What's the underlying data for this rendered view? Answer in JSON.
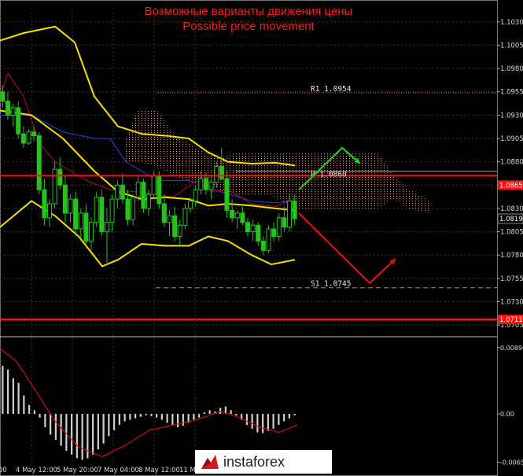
{
  "title_ru": "Возможные варианты движения цены",
  "title_en": "Possible price movement",
  "watermark": "instaforex",
  "colors": {
    "background": "#000000",
    "grid": "#3a3a3a",
    "candle": "#27c21c",
    "bollinger": "#f5e000",
    "kijun": "#1c3ccc",
    "tenkan": "#c20f0f",
    "cloud": "#e0a070",
    "level_red": "#ff1010",
    "arrow_green": "#20d020",
    "arrow_red": "#e01010",
    "macd_hist": "#d0d0d0",
    "macd_signal": "#d01010",
    "axis_text": "#d8d8d8"
  },
  "chart_data": {
    "type": "candlestick",
    "y_axis": {
      "range": [
        1.0695,
        1.1045
      ],
      "ticks": [
        "1.1030",
        "1.1005",
        "1.0980",
        "1.0955",
        "1.0930",
        "1.0905",
        "1.0880",
        "1.0855",
        "1.0830",
        "1.0805",
        "1.0780",
        "1.0755",
        "1.0730",
        "1.0705"
      ],
      "highlighted": [
        {
          "label": "1.0865",
          "value": 1.0855,
          "bg": "#ff1010"
        },
        {
          "label": "1.0819",
          "value": 1.0819,
          "bg": "#000000"
        },
        {
          "label": "1.0711",
          "value": 1.0711,
          "bg": "#ff1010"
        }
      ]
    },
    "x_axis": {
      "ticks": [
        "00",
        "4 May 12:00",
        "5 May 20:00",
        "7 May 04:00",
        "8 May 12:00",
        "11 Ma"
      ]
    },
    "levels": [
      {
        "name": "R1",
        "label": "R1 1.0954",
        "value": 1.0954,
        "style": "dotted-red"
      },
      {
        "name": "P",
        "label": "P 1.0860",
        "value": 1.0865,
        "style": "solid-red"
      },
      {
        "name": "S1",
        "label": "S1 1.0745",
        "value": 1.0745,
        "style": "dashed-red"
      },
      {
        "name": "L",
        "label": "",
        "value": 1.0711,
        "style": "solid-red-thick"
      }
    ],
    "candles": [
      [
        1.0955,
        1.0962,
        1.0938,
        1.0945
      ],
      [
        1.0945,
        1.0955,
        1.0925,
        1.093
      ],
      [
        1.093,
        1.0942,
        1.0918,
        1.0938
      ],
      [
        1.0938,
        1.0945,
        1.0905,
        1.091
      ],
      [
        1.091,
        1.0918,
        1.0895,
        1.09
      ],
      [
        1.09,
        1.0915,
        1.0898,
        1.0912
      ],
      [
        1.0912,
        1.0918,
        1.0902,
        1.0908
      ],
      [
        1.0908,
        1.0912,
        1.0845,
        1.085
      ],
      [
        1.085,
        1.0862,
        1.0812,
        1.082
      ],
      [
        1.082,
        1.084,
        1.081,
        1.0835
      ],
      [
        1.0835,
        1.088,
        1.083,
        1.0872
      ],
      [
        1.0872,
        1.0885,
        1.085,
        1.0855
      ],
      [
        1.0855,
        1.0865,
        1.0815,
        1.0825
      ],
      [
        1.0825,
        1.0845,
        1.0815,
        1.084
      ],
      [
        1.084,
        1.0848,
        1.08,
        1.0808
      ],
      [
        1.0808,
        1.083,
        1.0798,
        1.0825
      ],
      [
        1.0825,
        1.0835,
        1.079,
        1.0795
      ],
      [
        1.0795,
        1.082,
        1.0785,
        1.0815
      ],
      [
        1.0815,
        1.0848,
        1.081,
        1.0842
      ],
      [
        1.0842,
        1.085,
        1.08,
        1.0805
      ],
      [
        1.0805,
        1.083,
        1.077,
        1.0815
      ],
      [
        1.0815,
        1.0845,
        1.0805,
        1.084
      ],
      [
        1.084,
        1.086,
        1.083,
        1.0855
      ],
      [
        1.0855,
        1.0868,
        1.0835,
        1.084
      ],
      [
        1.084,
        1.085,
        1.0812,
        1.0818
      ],
      [
        1.0818,
        1.0845,
        1.0812,
        1.0842
      ],
      [
        1.0842,
        1.0865,
        1.0838,
        1.0858
      ],
      [
        1.0858,
        1.0862,
        1.0825,
        1.083
      ],
      [
        1.083,
        1.085,
        1.0822,
        1.0845
      ],
      [
        1.0845,
        1.087,
        1.084,
        1.0865
      ],
      [
        1.0865,
        1.087,
        1.083,
        1.0835
      ],
      [
        1.0835,
        1.0845,
        1.081,
        1.0815
      ],
      [
        1.0815,
        1.0828,
        1.08,
        1.0822
      ],
      [
        1.0822,
        1.0832,
        1.0795,
        1.08
      ],
      [
        1.08,
        1.0818,
        1.079,
        1.0812
      ],
      [
        1.0812,
        1.0835,
        1.0808,
        1.083
      ],
      [
        1.083,
        1.0842,
        1.0825,
        1.0838
      ],
      [
        1.0838,
        1.0855,
        1.0832,
        1.085
      ],
      [
        1.085,
        1.087,
        1.0845,
        1.0862
      ],
      [
        1.0862,
        1.0868,
        1.0845,
        1.085
      ],
      [
        1.085,
        1.0862,
        1.084,
        1.0858
      ],
      [
        1.0858,
        1.088,
        1.0852,
        1.0875
      ],
      [
        1.0875,
        1.0895,
        1.086,
        1.0862
      ],
      [
        1.0862,
        1.087,
        1.082,
        1.0828
      ],
      [
        1.0828,
        1.084,
        1.0815,
        1.082
      ],
      [
        1.082,
        1.0828,
        1.0808,
        1.0825
      ],
      [
        1.0825,
        1.0832,
        1.0812,
        1.0815
      ],
      [
        1.0815,
        1.082,
        1.08,
        1.0805
      ],
      [
        1.0805,
        1.0818,
        1.0795,
        1.0812
      ],
      [
        1.0812,
        1.0815,
        1.079,
        1.0795
      ],
      [
        1.0795,
        1.08,
        1.078,
        1.0785
      ],
      [
        1.0785,
        1.0812,
        1.0782,
        1.0808
      ],
      [
        1.0808,
        1.0815,
        1.0795,
        1.08
      ],
      [
        1.08,
        1.0825,
        1.0795,
        1.082
      ],
      [
        1.082,
        1.0832,
        1.0805,
        1.081
      ],
      [
        1.081,
        1.0845,
        1.0805,
        1.0838
      ],
      [
        1.0838,
        1.0845,
        1.0812,
        1.0819
      ]
    ],
    "bollinger_upper": [
      [
        0,
        1.101
      ],
      [
        30,
        1.1018
      ],
      [
        70,
        1.1025
      ],
      [
        95,
        1.1008
      ],
      [
        120,
        1.095
      ],
      [
        150,
        1.0918
      ],
      [
        180,
        1.091
      ],
      [
        210,
        1.0908
      ],
      [
        240,
        1.0905
      ],
      [
        265,
        1.089
      ],
      [
        290,
        1.088
      ],
      [
        320,
        1.0878
      ],
      [
        350,
        1.0879
      ],
      [
        375,
        1.0876
      ]
    ],
    "bollinger_mid": [
      [
        0,
        1.0935
      ],
      [
        40,
        1.093
      ],
      [
        80,
        1.0905
      ],
      [
        120,
        1.087
      ],
      [
        150,
        1.0848
      ],
      [
        180,
        1.084
      ],
      [
        210,
        1.0842
      ],
      [
        240,
        1.084
      ],
      [
        265,
        1.0833
      ],
      [
        290,
        1.0835
      ],
      [
        320,
        1.0833
      ],
      [
        350,
        1.083
      ],
      [
        375,
        1.0828
      ]
    ],
    "bollinger_lower": [
      [
        0,
        1.081
      ],
      [
        40,
        1.0838
      ],
      [
        70,
        1.0822
      ],
      [
        100,
        1.08
      ],
      [
        130,
        1.0768
      ],
      [
        150,
        1.0775
      ],
      [
        180,
        1.0792
      ],
      [
        210,
        1.079
      ],
      [
        240,
        1.079
      ],
      [
        265,
        1.08
      ],
      [
        290,
        1.0795
      ],
      [
        320,
        1.078
      ],
      [
        345,
        1.077
      ],
      [
        375,
        1.0775
      ]
    ],
    "kijun": [
      [
        0,
        1.093
      ],
      [
        40,
        1.093
      ],
      [
        80,
        1.0912
      ],
      [
        120,
        1.0905
      ],
      [
        140,
        1.0905
      ],
      [
        160,
        1.088
      ],
      [
        200,
        1.086
      ],
      [
        240,
        1.086
      ],
      [
        280,
        1.0848
      ],
      [
        320,
        1.0838
      ],
      [
        350,
        1.0836
      ],
      [
        375,
        1.0838
      ]
    ],
    "tenkan": [
      [
        0,
        1.095
      ],
      [
        10,
        1.0975
      ],
      [
        30,
        1.095
      ],
      [
        50,
        1.09
      ],
      [
        70,
        1.088
      ],
      [
        90,
        1.087
      ],
      [
        110,
        1.086
      ],
      [
        140,
        1.085
      ],
      [
        170,
        1.0848
      ],
      [
        200,
        1.0845
      ],
      [
        220,
        1.0842
      ],
      [
        250,
        1.086
      ],
      [
        270,
        1.0848
      ],
      [
        290,
        1.085
      ],
      [
        320,
        1.0835
      ],
      [
        350,
        1.0832
      ],
      [
        375,
        1.084
      ]
    ],
    "cloud_top": [
      [
        160,
        1.0905
      ],
      [
        175,
        1.0935
      ],
      [
        200,
        1.0935
      ],
      [
        220,
        1.091
      ],
      [
        240,
        1.09
      ],
      [
        260,
        1.089
      ],
      [
        280,
        1.0885
      ],
      [
        300,
        1.089
      ],
      [
        340,
        1.089
      ],
      [
        380,
        1.089
      ],
      [
        420,
        1.089
      ],
      [
        480,
        1.089
      ],
      [
        500,
        1.0865
      ],
      [
        520,
        1.085
      ],
      [
        545,
        1.084
      ]
    ],
    "cloud_bottom": [
      [
        160,
        1.088
      ],
      [
        175,
        1.088
      ],
      [
        200,
        1.0875
      ],
      [
        220,
        1.0865
      ],
      [
        240,
        1.0858
      ],
      [
        260,
        1.0855
      ],
      [
        280,
        1.085
      ],
      [
        300,
        1.0845
      ],
      [
        340,
        1.0845
      ],
      [
        380,
        1.083
      ],
      [
        420,
        1.083
      ],
      [
        480,
        1.083
      ],
      [
        500,
        1.084
      ],
      [
        520,
        1.083
      ],
      [
        545,
        1.0825
      ]
    ],
    "projection": {
      "bullish": [
        [
          380,
          1.085
        ],
        [
          435,
          1.0895
        ],
        [
          458,
          1.0878
        ]
      ],
      "bearish": [
        [
          380,
          1.0825
        ],
        [
          470,
          1.075
        ],
        [
          503,
          1.0776
        ]
      ]
    },
    "macd_panel": {
      "ticks": [
        "0.00896",
        "0.00",
        "-0.00653"
      ],
      "range": [
        -0.0068,
        0.01
      ],
      "histogram": [
        0.0065,
        0.006,
        0.0048,
        0.0042,
        0.0025,
        0.0012,
        0.0005,
        -0.0005,
        -0.0018,
        -0.0028,
        -0.0035,
        -0.0043,
        -0.005,
        -0.0055,
        -0.006,
        -0.0062,
        -0.006,
        -0.0055,
        -0.0048,
        -0.004,
        -0.003,
        -0.0022,
        -0.0015,
        -0.001,
        -0.0008,
        -0.0006,
        -0.0004,
        -0.0002,
        -0.0003,
        -0.0005,
        -0.0008,
        -0.0012,
        -0.0015,
        -0.0018,
        -0.0016,
        -0.0012,
        -0.0008,
        -0.0005,
        0.0002,
        0.0005,
        0.0003,
        0.0008,
        0.001,
        0.0005,
        -0.0002,
        -0.0008,
        -0.0015,
        -0.002,
        -0.0025,
        -0.0026,
        -0.0023,
        -0.002,
        -0.0015,
        -0.001,
        -0.0006,
        -0.0002
      ],
      "signal": [
        [
          0,
          0.0088
        ],
        [
          20,
          0.0072
        ],
        [
          40,
          0.004
        ],
        [
          70,
          -0.001
        ],
        [
          100,
          -0.0045
        ],
        [
          130,
          -0.0058
        ],
        [
          160,
          -0.0042
        ],
        [
          190,
          -0.0022
        ],
        [
          220,
          -0.0015
        ],
        [
          250,
          -0.0008
        ],
        [
          280,
          0.0003
        ],
        [
          300,
          -0.0003
        ],
        [
          330,
          -0.0018
        ],
        [
          355,
          -0.0025
        ],
        [
          378,
          -0.0015
        ]
      ]
    }
  }
}
